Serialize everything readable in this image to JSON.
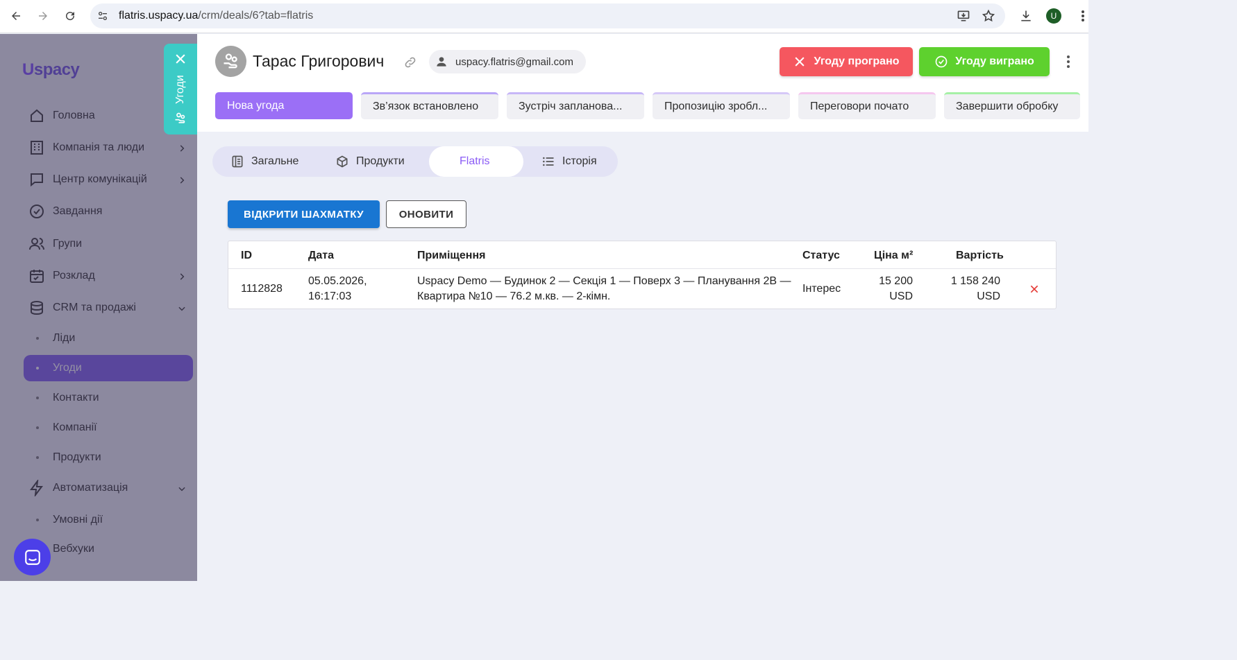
{
  "browser": {
    "url_host": "flatris.uspacy.ua",
    "url_path": "/crm/deals/6?tab=flatris",
    "profile_initial": "U"
  },
  "sidebar": {
    "logo": "spacy",
    "logo_u": "U",
    "items": [
      {
        "label": "Головна",
        "icon": "home-icon"
      },
      {
        "label": "Компанія та люди",
        "icon": "building-icon"
      },
      {
        "label": "Центр комунікацій",
        "icon": "chat-icon"
      },
      {
        "label": "Завдання",
        "icon": "check-circle-icon"
      },
      {
        "label": "Групи",
        "icon": "users-icon"
      },
      {
        "label": "Розклад",
        "icon": "calendar-icon"
      },
      {
        "label": "CRM та продажі",
        "icon": "database-icon"
      },
      {
        "label": "Автоматизація",
        "icon": "bolt-icon"
      }
    ],
    "crm_sub": [
      "Ліди",
      "Угоди",
      "Контакти",
      "Компанії",
      "Продукти"
    ],
    "auto_sub": [
      "Умовні дії",
      "Вебхуки"
    ],
    "active_sub": "Угоди"
  },
  "side_tab": {
    "label": "Угоди"
  },
  "deal": {
    "name": "Тарас Григорович",
    "email": "uspacy.flatris@gmail.com",
    "lost_label": "Угоду програно",
    "won_label": "Угоду виграно",
    "stages": [
      {
        "label": "Нова угода",
        "active": true,
        "color": "#9b6ff6"
      },
      {
        "label": "Зв’язок встановлено",
        "active": false,
        "color": "#b9a6f7"
      },
      {
        "label": "Зустріч запланова...",
        "active": false,
        "color": "#c7b7f7"
      },
      {
        "label": "Пропозицію зробл...",
        "active": false,
        "color": "#d5c8f7"
      },
      {
        "label": "Переговори почато",
        "active": false,
        "color": "#f5c7ef"
      },
      {
        "label": "Завершити обробку",
        "active": false,
        "color": "#a6f0a6"
      }
    ]
  },
  "tabs": [
    {
      "label": "Загальне",
      "icon": "document-icon"
    },
    {
      "label": "Продукти",
      "icon": "cube-icon"
    },
    {
      "label": "Flatris",
      "icon": ""
    },
    {
      "label": "Історія",
      "icon": "list-icon"
    }
  ],
  "active_tab": "Flatris",
  "actions": {
    "open_chess": "ВІДКРИТИ ШАХМАТКУ",
    "refresh": "ОНОВИТИ"
  },
  "table": {
    "headers": [
      "ID",
      "Дата",
      "Приміщення",
      "Статус",
      "Ціна м²",
      "Вартість"
    ],
    "rows": [
      {
        "id": "1112828",
        "date_line1": "05.05.2026,",
        "date_line2": "16:17:03",
        "premises_line1": "Uspacy Demo — Будинок 2 — Секція 1 — Поверх 3 — Планування 2В —",
        "premises_line2": "Квартира №10 — 76.2 м.кв. — 2-кімн.",
        "status": "Інтерес",
        "price_m2_line1": "15 200",
        "price_m2_line2": "USD",
        "total_line1": "1 158 240",
        "total_line2": "USD"
      }
    ]
  },
  "colors": {
    "accent": "#9b6ff6",
    "primary": "#1976d2",
    "lost": "#f5575f",
    "won": "#5ed12e",
    "side_tab": "#3ccbc6"
  }
}
